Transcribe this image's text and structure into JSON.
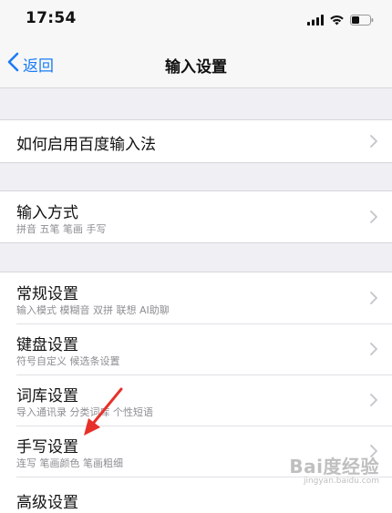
{
  "status_bar": {
    "time": "17:54"
  },
  "nav": {
    "back_label": "返回",
    "title": "输入设置"
  },
  "groups": {
    "help": {
      "title": "如何启用百度输入法"
    },
    "input_method": {
      "title": "输入方式",
      "subtitle": "拼音 五笔 笔画 手写"
    },
    "settings": {
      "general": {
        "title": "常规设置",
        "subtitle": "输入模式 模糊音 双拼 联想 AI助聊"
      },
      "keyboard": {
        "title": "键盘设置",
        "subtitle": "符号自定义 候选条设置"
      },
      "lexicon": {
        "title": "词库设置",
        "subtitle": "导入通讯录 分类词库 个性短语"
      },
      "handwriting": {
        "title": "手写设置",
        "subtitle": "连写 笔画颜色 笔画粗细"
      },
      "partial_next": {
        "title": "高级设置"
      }
    }
  },
  "watermark": {
    "logo": "Bai度经验",
    "url": "jingyan.baidu.com"
  },
  "colors": {
    "accent": "#1a7cf5",
    "background": "#efeff4",
    "annotation": "#e8302a"
  },
  "icons": {
    "signal": "signal-icon",
    "wifi": "wifi-icon",
    "battery": "battery-icon",
    "back": "chevron-left-icon",
    "disclosure": "chevron-right-icon"
  }
}
